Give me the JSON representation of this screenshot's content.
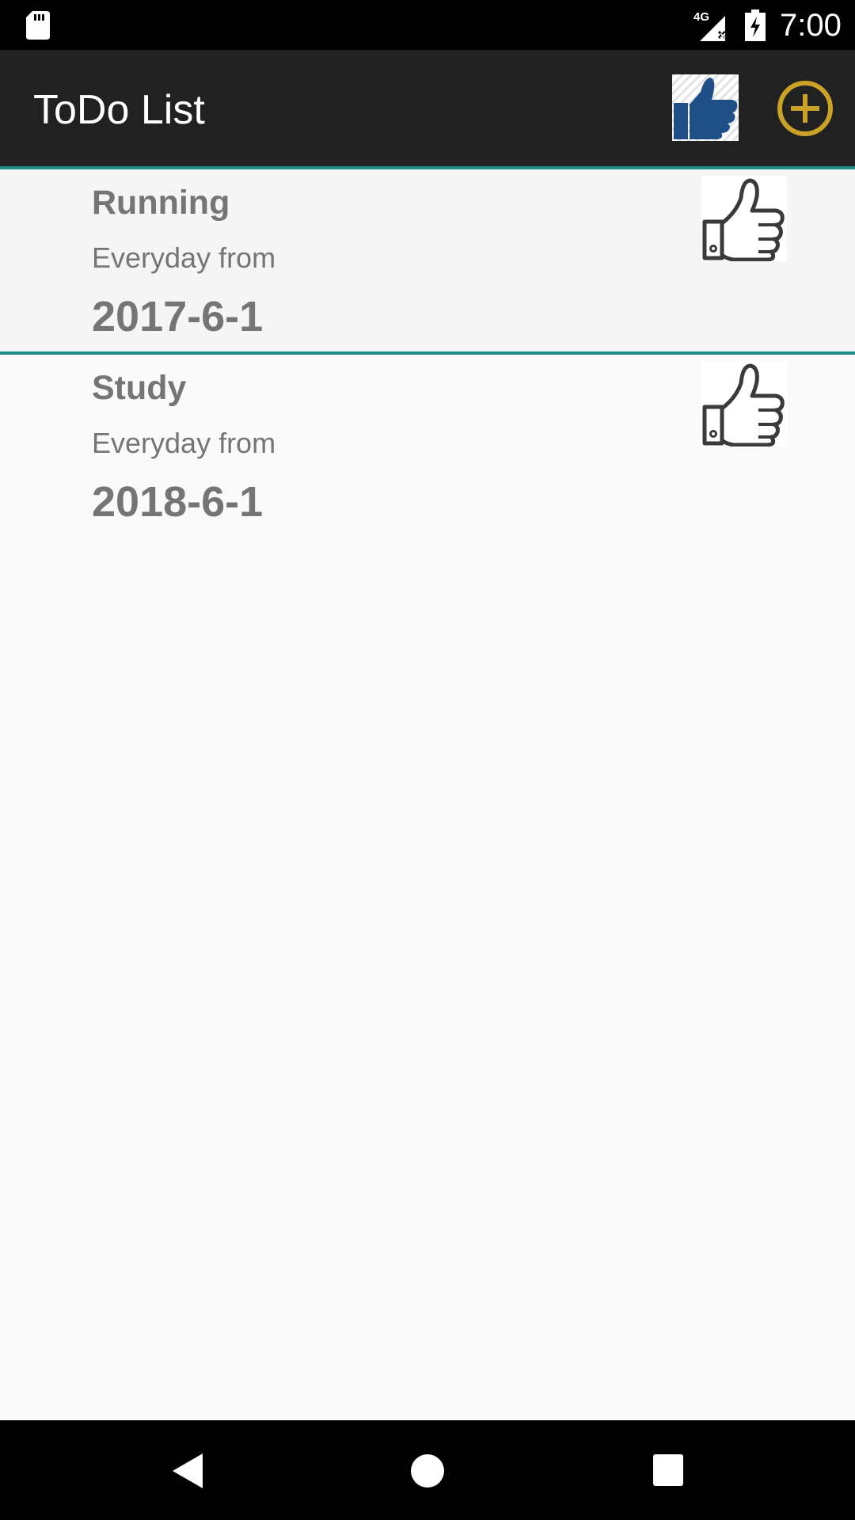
{
  "status_bar": {
    "time": "7:00",
    "network": "4G",
    "icons": [
      "sd-card-icon",
      "signal-icon",
      "battery-charging-icon"
    ]
  },
  "app_bar": {
    "title": "ToDo List",
    "actions": [
      {
        "name": "thumbs-up-icon",
        "color": "#1e4f86"
      },
      {
        "name": "add-circle-icon",
        "color": "#c9a227"
      }
    ]
  },
  "todos": [
    {
      "name": "Running",
      "frequency": "Everyday from",
      "date": "2017-6-1",
      "icon": "thumbs-up-outline-icon"
    },
    {
      "name": "Study",
      "frequency": "Everyday from",
      "date": "2018-6-1",
      "icon": "thumbs-up-outline-icon"
    }
  ],
  "colors": {
    "divider": "#1f8d86",
    "app_bar_bg": "#212121",
    "text_secondary": "#757575"
  },
  "nav_bar": {
    "buttons": [
      "back-icon",
      "home-icon",
      "recents-icon"
    ]
  }
}
